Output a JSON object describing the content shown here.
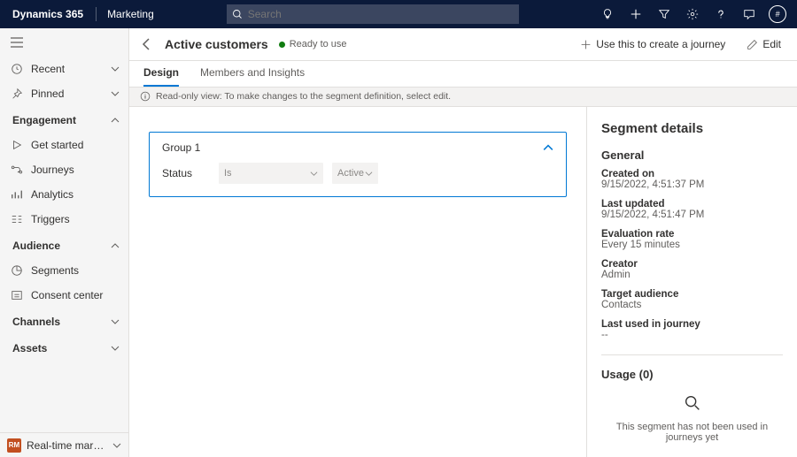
{
  "topbar": {
    "brand": "Dynamics 365",
    "area": "Marketing",
    "search_placeholder": "Search",
    "avatar_initial": "#"
  },
  "sidebar": {
    "recent": "Recent",
    "pinned": "Pinned",
    "sections": {
      "engagement": {
        "label": "Engagement",
        "items": [
          "Get started",
          "Journeys",
          "Analytics",
          "Triggers"
        ]
      },
      "audience": {
        "label": "Audience",
        "items": [
          "Segments",
          "Consent center"
        ]
      },
      "channels": {
        "label": "Channels"
      },
      "assets": {
        "label": "Assets"
      }
    },
    "footer": {
      "badge": "RM",
      "label": "Real-time marketi..."
    }
  },
  "page": {
    "title": "Active customers",
    "status": "Ready to use",
    "commands": {
      "journey": "Use this to create a journey",
      "edit": "Edit"
    }
  },
  "tabs": {
    "design": "Design",
    "members": "Members and Insights"
  },
  "infobar": "Read-only view: To make changes to the segment definition, select edit.",
  "designer": {
    "group_label": "Group 1",
    "attr": "Status",
    "operator": "Is",
    "value": "Active"
  },
  "details": {
    "title": "Segment details",
    "general": "General",
    "fields": {
      "created_on": {
        "k": "Created on",
        "v": "9/15/2022, 4:51:37 PM"
      },
      "last_updated": {
        "k": "Last updated",
        "v": "9/15/2022, 4:51:47 PM"
      },
      "evaluation_rate": {
        "k": "Evaluation rate",
        "v": "Every 15 minutes"
      },
      "creator": {
        "k": "Creator",
        "v": "Admin"
      },
      "target_audience": {
        "k": "Target audience",
        "v": "Contacts"
      },
      "last_used": {
        "k": "Last used in journey",
        "v": "--"
      }
    },
    "usage_title": "Usage (0)",
    "usage_empty": "This segment has not been used in journeys yet"
  }
}
